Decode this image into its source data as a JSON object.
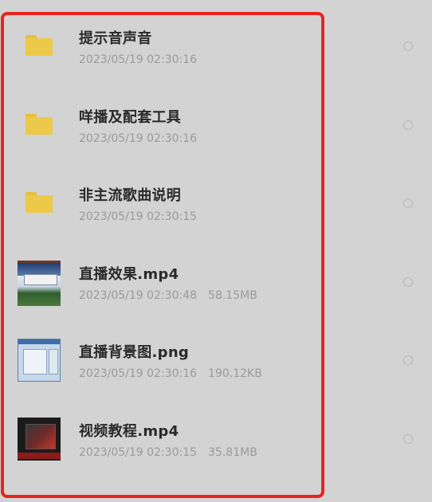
{
  "files": [
    {
      "type": "folder",
      "icon": "folder-icon",
      "name": "提示音声音",
      "date": "2023/05/19 02:30:16",
      "size": ""
    },
    {
      "type": "folder",
      "icon": "folder-icon",
      "name": "咩播及配套工具",
      "date": "2023/05/19 02:30:16",
      "size": ""
    },
    {
      "type": "folder",
      "icon": "folder-icon",
      "name": "非主流歌曲说明",
      "date": "2023/05/19 02:30:15",
      "size": ""
    },
    {
      "type": "video",
      "icon": "video-thumbnail",
      "name": "直播效果.mp4",
      "date": "2023/05/19 02:30:48",
      "size": "58.15MB"
    },
    {
      "type": "image",
      "icon": "image-thumbnail",
      "name": "直播背景图.png",
      "date": "2023/05/19 02:30:16",
      "size": "190.12KB"
    },
    {
      "type": "video",
      "icon": "video-thumbnail",
      "name": "视频教程.mp4",
      "date": "2023/05/19 02:30:15",
      "size": "35.81MB"
    }
  ],
  "colors": {
    "background": "#d3d3d3",
    "highlight_border": "#e8241f",
    "folder": "#ecc949",
    "name_text": "#2a2a2a",
    "meta_text": "#9a9a9a"
  }
}
